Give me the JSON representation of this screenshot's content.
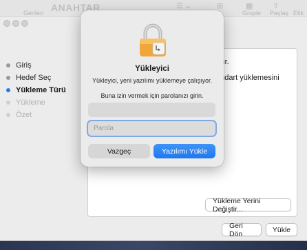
{
  "background_window": {
    "title": "ANAHTAR",
    "toolbar": {
      "left_label": "Gerileri",
      "right_labels": [
        "Gruple",
        "Paylaş",
        "Etik"
      ]
    },
    "steps": [
      {
        "label": "Giriş",
        "state": "done"
      },
      {
        "label": "Hedef Seç",
        "state": "done"
      },
      {
        "label": "Yükleme Türü",
        "state": "active"
      },
      {
        "label": "Yükleme",
        "state": "pending"
      },
      {
        "label": "Özet",
        "state": "pending"
      }
    ],
    "content_lines": [
      "ktır.",
      "andart yüklemesini"
    ],
    "change_location_button": "Yükleme Yerini Değiştir...",
    "back_button": "Geri Dön",
    "install_button": "Yükle"
  },
  "auth_dialog": {
    "title": "Yükleyici",
    "message": "Yükleyici, yeni yazılımı yüklemeye çalışıyor.",
    "prompt": "Buna izin vermek için parolanızı girin.",
    "username_value": "",
    "password_placeholder": "Parola",
    "cancel_button": "Vazgeç",
    "confirm_button": "Yazılımı Yükle"
  },
  "colors": {
    "accent": "#1f78ef",
    "active_step_dot": "#2a7de0"
  }
}
